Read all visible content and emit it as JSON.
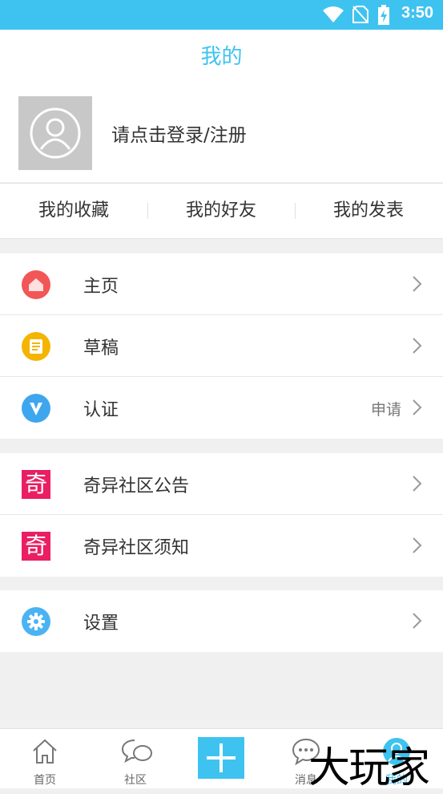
{
  "status_bar": {
    "time": "3:50"
  },
  "header": {
    "title": "我的"
  },
  "profile": {
    "login_prompt": "请点击登录/注册"
  },
  "quick_links": [
    "我的收藏",
    "我的好友",
    "我的发表"
  ],
  "menu_group_1": [
    {
      "label": "主页",
      "icon": "home-icon",
      "right": ""
    },
    {
      "label": "草稿",
      "icon": "draft-icon",
      "right": ""
    },
    {
      "label": "认证",
      "icon": "verify-icon",
      "right": "申请"
    }
  ],
  "menu_group_2": [
    {
      "label": "奇异社区公告",
      "icon": "qi-icon",
      "icon_text": "奇"
    },
    {
      "label": "奇异社区须知",
      "icon": "qi-icon",
      "icon_text": "奇"
    }
  ],
  "menu_group_3": [
    {
      "label": "设置",
      "icon": "gear-icon"
    }
  ],
  "tab_bar": [
    {
      "label": "首页",
      "icon": "home-outline-icon"
    },
    {
      "label": "社区",
      "icon": "community-icon"
    },
    {
      "label": "",
      "icon": "plus-icon"
    },
    {
      "label": "消息",
      "icon": "message-icon"
    },
    {
      "label": "我的",
      "icon": "profile-icon",
      "active": true
    }
  ],
  "watermark": "大玩家",
  "colors": {
    "accent": "#3ec3f0",
    "home_icon": "#f25656",
    "draft_icon": "#f5b400",
    "verify_icon": "#3ea6ef",
    "qi_icon": "#e91e63",
    "gear_icon": "#4ab3f4"
  }
}
